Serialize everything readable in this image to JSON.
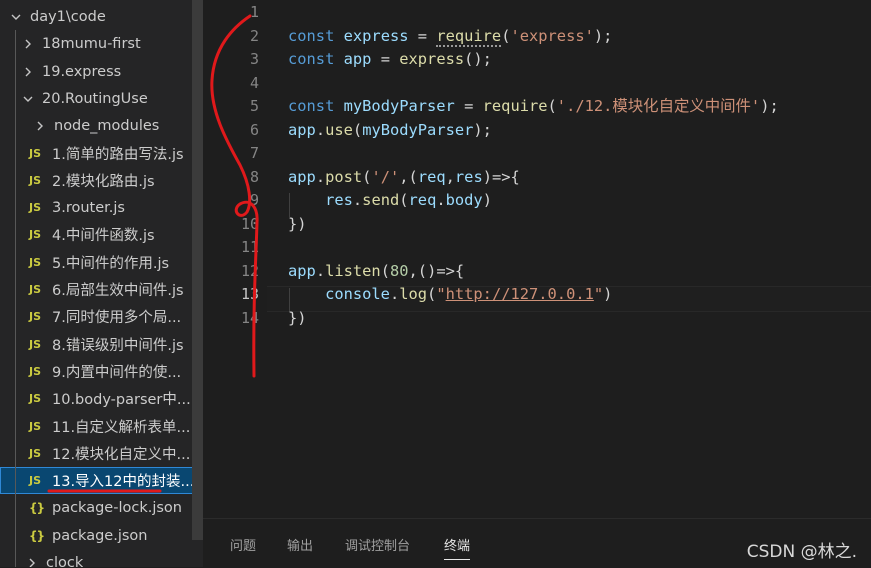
{
  "explorer": {
    "items": [
      {
        "label": "day1\\code",
        "kind": "folder",
        "open": true,
        "icon": "chevron-down-icon"
      },
      {
        "label": "18mumu-first",
        "kind": "folder",
        "open": false,
        "icon": "chevron-right-icon"
      },
      {
        "label": "19.express",
        "kind": "folder",
        "open": false,
        "icon": "chevron-right-icon"
      },
      {
        "label": "20.RoutingUse",
        "kind": "folder",
        "open": true,
        "icon": "chevron-down-icon"
      },
      {
        "label": "node_modules",
        "kind": "folder",
        "open": false,
        "icon": "chevron-right-icon"
      },
      {
        "label": "1.简单的路由写法.js",
        "kind": "js",
        "badge": "JS"
      },
      {
        "label": "2.模块化路由.js",
        "kind": "js",
        "badge": "JS"
      },
      {
        "label": "3.router.js",
        "kind": "js",
        "badge": "JS"
      },
      {
        "label": "4.中间件函数.js",
        "kind": "js",
        "badge": "JS"
      },
      {
        "label": "5.中间件的作用.js",
        "kind": "js",
        "badge": "JS"
      },
      {
        "label": "6.局部生效中间件.js",
        "kind": "js",
        "badge": "JS"
      },
      {
        "label": "7.同时使用多个局...",
        "kind": "js",
        "badge": "JS"
      },
      {
        "label": "8.错误级别中间件.js",
        "kind": "js",
        "badge": "JS"
      },
      {
        "label": "9.内置中间件的使...",
        "kind": "js",
        "badge": "JS"
      },
      {
        "label": "10.body-parser中...",
        "kind": "js",
        "badge": "JS"
      },
      {
        "label": "11.自定义解析表单...",
        "kind": "js",
        "badge": "JS"
      },
      {
        "label": "12.模块化自定义中...",
        "kind": "js",
        "badge": "JS"
      },
      {
        "label": "13.导入12中的封装...",
        "kind": "js",
        "badge": "JS",
        "selected": true
      },
      {
        "label": "package-lock.json",
        "kind": "json",
        "badge": "{}"
      },
      {
        "label": "package.json",
        "kind": "json",
        "badge": "{}"
      },
      {
        "label": "clock",
        "kind": "folder",
        "open": false,
        "icon": "chevron-right-icon"
      }
    ]
  },
  "editor": {
    "line_numbers": [
      "1",
      "2",
      "3",
      "4",
      "5",
      "6",
      "7",
      "8",
      "9",
      "10",
      "11",
      "12",
      "13",
      "14"
    ],
    "active_line": "13",
    "lines": [
      [],
      [
        [
          "kw",
          "const"
        ],
        [
          "p",
          " "
        ],
        [
          "v",
          "express"
        ],
        [
          "p",
          " = "
        ],
        [
          "f",
          "require"
        ],
        [
          "p",
          "("
        ],
        [
          "s",
          "'express'"
        ],
        [
          "p",
          ");"
        ]
      ],
      [
        [
          "kw",
          "const"
        ],
        [
          "p",
          " "
        ],
        [
          "v",
          "app"
        ],
        [
          "p",
          " = "
        ],
        [
          "f",
          "express"
        ],
        [
          "p",
          "();"
        ]
      ],
      [],
      [
        [
          "kw",
          "const"
        ],
        [
          "p",
          " "
        ],
        [
          "v",
          "myBodyParser"
        ],
        [
          "p",
          " = "
        ],
        [
          "f",
          "require"
        ],
        [
          "p",
          "("
        ],
        [
          "s",
          "'./12.模块化自定义中间件'"
        ],
        [
          "p",
          ");"
        ]
      ],
      [
        [
          "v",
          "app"
        ],
        [
          "p",
          "."
        ],
        [
          "f",
          "use"
        ],
        [
          "p",
          "("
        ],
        [
          "v",
          "myBodyParser"
        ],
        [
          "p",
          ");"
        ]
      ],
      [],
      [
        [
          "v",
          "app"
        ],
        [
          "p",
          "."
        ],
        [
          "f",
          "post"
        ],
        [
          "p",
          "("
        ],
        [
          "s",
          "'/'"
        ],
        [
          "p",
          ",("
        ],
        [
          "v",
          "req"
        ],
        [
          "p",
          ","
        ],
        [
          "v",
          "res"
        ],
        [
          "p",
          ")=>{"
        ]
      ],
      [
        [
          "p",
          "    "
        ],
        [
          "v",
          "res"
        ],
        [
          "p",
          "."
        ],
        [
          "f",
          "send"
        ],
        [
          "p",
          "("
        ],
        [
          "v",
          "req"
        ],
        [
          "p",
          "."
        ],
        [
          "v",
          "body"
        ],
        [
          "p",
          ")"
        ]
      ],
      [
        [
          "p",
          "})"
        ]
      ],
      [],
      [
        [
          "v",
          "app"
        ],
        [
          "p",
          "."
        ],
        [
          "f",
          "listen"
        ],
        [
          "p",
          "("
        ],
        [
          "n",
          "80"
        ],
        [
          "p",
          ",()=>{"
        ]
      ],
      [
        [
          "p",
          "    "
        ],
        [
          "v",
          "console"
        ],
        [
          "p",
          "."
        ],
        [
          "f",
          "log"
        ],
        [
          "p",
          "("
        ],
        [
          "s",
          "\""
        ],
        [
          "s link",
          "http://127.0.0.1"
        ],
        [
          "s",
          "\""
        ],
        [
          "p",
          ")"
        ]
      ],
      [
        [
          "p",
          "})"
        ]
      ]
    ]
  },
  "panel": {
    "tabs": [
      {
        "label": "问题",
        "active": false
      },
      {
        "label": "输出",
        "active": false
      },
      {
        "label": "调试控制台",
        "active": false
      },
      {
        "label": "终端",
        "active": true
      }
    ]
  },
  "watermark": "CSDN @林之.",
  "colors": {
    "annotation": "#e0191b",
    "selection": "#094771",
    "sidebar": "#252526",
    "editor": "#1e1e1e"
  }
}
